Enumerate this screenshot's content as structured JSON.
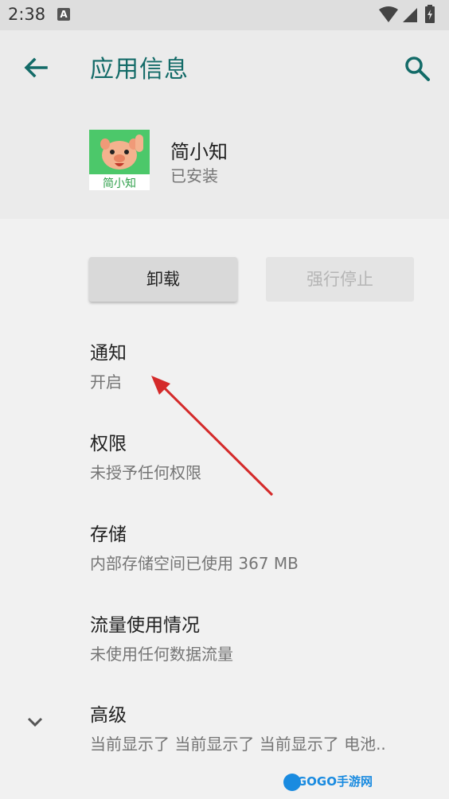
{
  "status_bar": {
    "time": "2:38",
    "notification_letter": "A",
    "icons": [
      "wifi-icon",
      "signal-icon",
      "battery-icon"
    ]
  },
  "header": {
    "title": "应用信息",
    "app_name": "简小知",
    "app_status": "已安装",
    "app_icon_text": "简小知"
  },
  "buttons": {
    "uninstall": "卸载",
    "force_stop": "强行停止"
  },
  "items": [
    {
      "title": "通知",
      "subtitle": "开启"
    },
    {
      "title": "权限",
      "subtitle": "未授予任何权限"
    },
    {
      "title": "存储",
      "subtitle": "内部存储空间已使用 367 MB"
    },
    {
      "title": "流量使用情况",
      "subtitle": "未使用任何数据流量"
    },
    {
      "title": "高级",
      "subtitle": "当前显示了 当前显示了 当前显示了 电池.."
    }
  ],
  "watermark": "GOGO手游网",
  "colors": {
    "accent": "#136b68",
    "annotation_arrow": "#d42a2a"
  }
}
